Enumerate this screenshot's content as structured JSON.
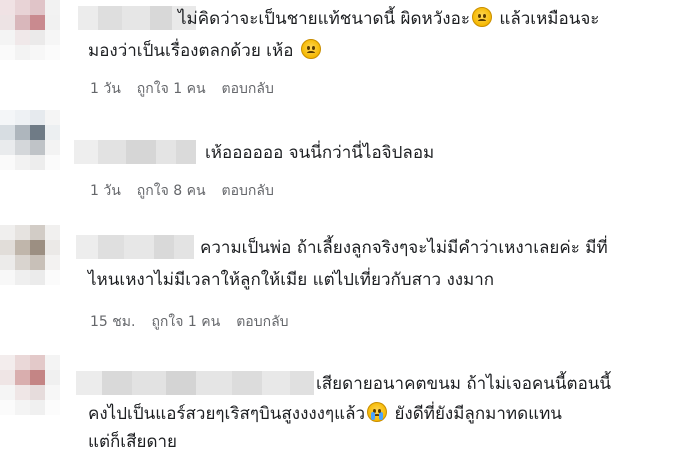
{
  "comments": [
    {
      "lines": [
        "ไม่คิดว่าจะเป็นชายแท้ชนาดนี้ ผิดหวังอะ",
        " แล้วเหมือนจะ",
        "มองว่าเป็นเรื่องตลกด้วย เห้อ "
      ],
      "time": "1 วัน",
      "like": "ถูกใจ 1 คน",
      "reply": "ตอบกลับ"
    },
    {
      "lines": [
        "เห้ออออออ จนนี่กว่านี่ไอจิปลอม"
      ],
      "time": "1 วัน",
      "like": "ถูกใจ 8 คน",
      "reply": "ตอบกลับ"
    },
    {
      "lines": [
        "ความเป็นพ่อ ถ้าเลี้ยงลูกจริงๆจะไม่มีคำว่าเหงาเลยค่ะ มีที่",
        "ไหนเหงาไม่มีเวลาให้ลูกให้เมีย แต่ไปเที่ยวกับสาว งงมาก"
      ],
      "time": "15 ชม.",
      "like": "ถูกใจ 1 คน",
      "reply": "ตอบกลับ"
    },
    {
      "lines": [
        "เสียดายอนาคตขนม ถ้าไม่เจอคนนี้ตอนนี้",
        "คงไปเป็นแอร์สวยๆเริสๆบินสูงงงงๆแล้ว",
        " ยังดีที่ยังมีลูกมาทดแทน",
        "แต่ก็เสียดาย"
      ]
    }
  ],
  "emoji": {
    "sad": "sad-face",
    "cry": "crying-face"
  }
}
